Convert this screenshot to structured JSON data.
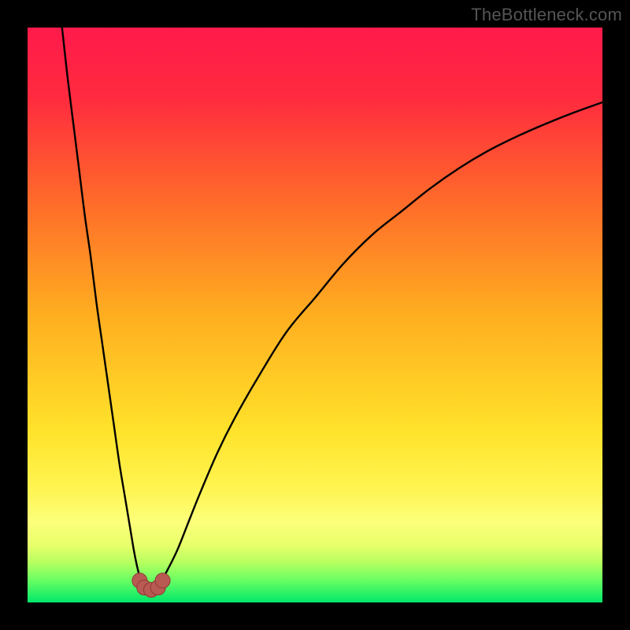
{
  "watermark": "TheBottleneck.com",
  "colors": {
    "frame": "#000000",
    "gradient_stops": [
      {
        "offset": 0.0,
        "color": "#ff1a4b"
      },
      {
        "offset": 0.12,
        "color": "#ff2a3f"
      },
      {
        "offset": 0.3,
        "color": "#ff6a2a"
      },
      {
        "offset": 0.5,
        "color": "#ffae20"
      },
      {
        "offset": 0.7,
        "color": "#ffe22a"
      },
      {
        "offset": 0.8,
        "color": "#fff450"
      },
      {
        "offset": 0.86,
        "color": "#fcff7a"
      },
      {
        "offset": 0.9,
        "color": "#e8ff6a"
      },
      {
        "offset": 0.93,
        "color": "#b8ff60"
      },
      {
        "offset": 0.96,
        "color": "#6cff62"
      },
      {
        "offset": 1.0,
        "color": "#00e86a"
      }
    ],
    "marker_fill": "#b85a52",
    "marker_stroke": "#8e3a36",
    "curve": "#000000",
    "watermark": "#555555"
  },
  "chart_data": {
    "type": "line",
    "title": "",
    "xlabel": "",
    "ylabel": "",
    "xlim": [
      0,
      100
    ],
    "ylim": [
      0,
      100
    ],
    "series": [
      {
        "name": "left-branch",
        "x": [
          6,
          7,
          8,
          9,
          10,
          11,
          12,
          13,
          14,
          15,
          16,
          17,
          18,
          18.5,
          19,
          19.5,
          20
        ],
        "y": [
          100,
          91,
          83,
          75,
          67,
          60,
          52,
          45,
          38,
          31,
          24,
          18,
          12,
          9,
          6.5,
          4.5,
          3.2
        ]
      },
      {
        "name": "right-branch",
        "x": [
          23,
          24,
          26,
          28,
          30,
          33,
          36,
          40,
          45,
          50,
          55,
          60,
          65,
          70,
          75,
          80,
          85,
          90,
          95,
          100
        ],
        "y": [
          3.2,
          5,
          9,
          14,
          19,
          26,
          32,
          39,
          47,
          53,
          59,
          64,
          68,
          72,
          75.5,
          78.5,
          81,
          83.2,
          85.2,
          87
        ]
      }
    ],
    "markers": [
      {
        "x": 19.5,
        "y": 3.8
      },
      {
        "x": 20.3,
        "y": 2.6
      },
      {
        "x": 21.5,
        "y": 2.2
      },
      {
        "x": 22.7,
        "y": 2.6
      },
      {
        "x": 23.5,
        "y": 3.8
      }
    ],
    "notch_min": {
      "x": 21.5,
      "y": 2.0
    }
  }
}
